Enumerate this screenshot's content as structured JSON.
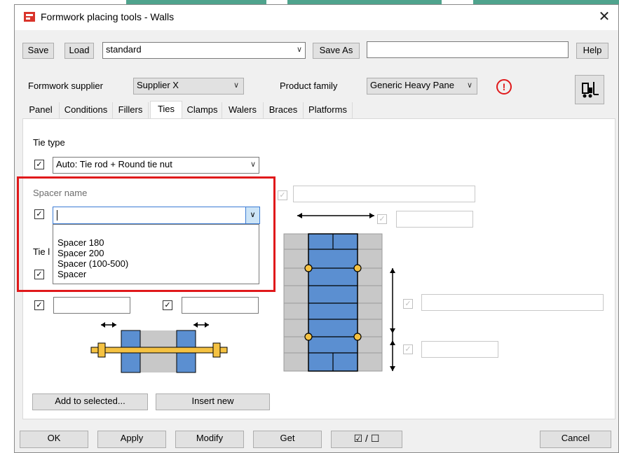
{
  "window": {
    "title": "Formwork placing tools - Walls",
    "close_label": "✕"
  },
  "toolbar": {
    "save_label": "Save",
    "load_label": "Load",
    "preset_value": "standard",
    "save_as_label": "Save As",
    "save_as_value": "",
    "help_label": "Help"
  },
  "supplier": {
    "label": "Formwork supplier",
    "value": "Supplier X",
    "product_label": "Product family",
    "product_value": "Generic Heavy Pane"
  },
  "tabs": [
    {
      "label": "Panel"
    },
    {
      "label": "Conditions"
    },
    {
      "label": "Fillers"
    },
    {
      "label": "Ties"
    },
    {
      "label": "Clamps"
    },
    {
      "label": "Walers"
    },
    {
      "label": "Braces"
    },
    {
      "label": "Platforms"
    }
  ],
  "ties": {
    "tie_type_label": "Tie type",
    "tie_type_value": "Auto: Tie rod + Round tie nut",
    "spacer_label": "Spacer name",
    "spacer_value": "",
    "tie_partial_label": "Tie l",
    "spacer_options": [
      "Spacer 180",
      "Spacer 200",
      "Spacer (100-500)",
      "Spacer"
    ]
  },
  "actions": {
    "add_selected_label": "Add to selected...",
    "insert_new_label": "Insert new"
  },
  "bottom": {
    "ok_label": "OK",
    "apply_label": "Apply",
    "modify_label": "Modify",
    "get_label": "Get",
    "toggle_label": "☑ / ☐",
    "cancel_label": "Cancel"
  },
  "colors": {
    "accent": "#e0191b",
    "wall_blue": "#5b8fd1",
    "tie_yellow": "#f5c242",
    "strip_green": "#4fa38d"
  }
}
